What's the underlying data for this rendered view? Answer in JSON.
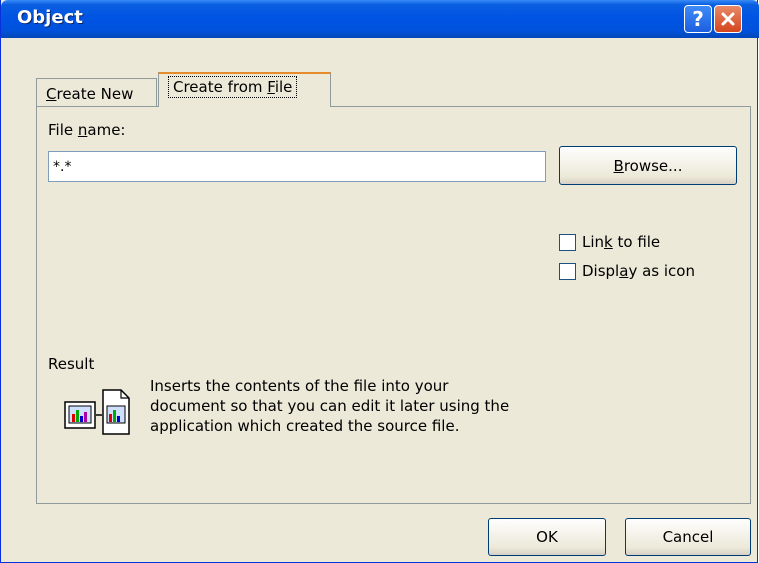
{
  "window": {
    "title": "Object",
    "help_glyph": "?",
    "close_glyph": "✕"
  },
  "tabs": [
    {
      "label_pre": "C",
      "label_ul": "",
      "label_post": "reate New",
      "label": "Create New",
      "mnemonic": "C",
      "active": false
    },
    {
      "label_pre": "Create from ",
      "label_ul": "F",
      "label_post": "ile",
      "label": "Create from File",
      "mnemonic": "F",
      "active": true
    }
  ],
  "file_name": {
    "label_pre": "File ",
    "label_ul": "n",
    "label_post": "ame:",
    "value": "*.*"
  },
  "browse_button": {
    "label_ul": "B",
    "label_post": "rowse..."
  },
  "options": [
    {
      "label_pre": "Lin",
      "label_ul": "k",
      "label_post": " to file",
      "checked": false
    },
    {
      "label_pre": "Displ",
      "label_ul": "a",
      "label_post": "y as icon",
      "checked": false
    }
  ],
  "result": {
    "label": "Result",
    "lines": [
      "Inserts the contents of the file into your",
      "document so that you can edit it later using the",
      "application which created the source file."
    ]
  },
  "footer": {
    "ok_label": "OK",
    "cancel_label": "Cancel"
  },
  "colors": {
    "titlebar": "#0054e3",
    "dialog_bg": "#ece9d8",
    "active_tab_accent": "#e68b2c",
    "close_button": "#d4451d"
  }
}
